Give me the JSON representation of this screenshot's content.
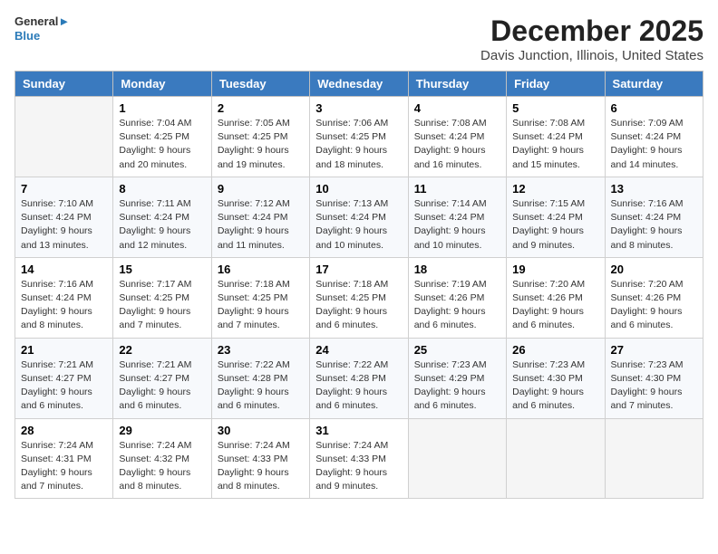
{
  "header": {
    "logo_line1": "General",
    "logo_line2": "Blue",
    "title": "December 2025",
    "subtitle": "Davis Junction, Illinois, United States"
  },
  "weekdays": [
    "Sunday",
    "Monday",
    "Tuesday",
    "Wednesday",
    "Thursday",
    "Friday",
    "Saturday"
  ],
  "weeks": [
    [
      {
        "day": "",
        "info": ""
      },
      {
        "day": "1",
        "info": "Sunrise: 7:04 AM\nSunset: 4:25 PM\nDaylight: 9 hours\nand 20 minutes."
      },
      {
        "day": "2",
        "info": "Sunrise: 7:05 AM\nSunset: 4:25 PM\nDaylight: 9 hours\nand 19 minutes."
      },
      {
        "day": "3",
        "info": "Sunrise: 7:06 AM\nSunset: 4:25 PM\nDaylight: 9 hours\nand 18 minutes."
      },
      {
        "day": "4",
        "info": "Sunrise: 7:08 AM\nSunset: 4:24 PM\nDaylight: 9 hours\nand 16 minutes."
      },
      {
        "day": "5",
        "info": "Sunrise: 7:08 AM\nSunset: 4:24 PM\nDaylight: 9 hours\nand 15 minutes."
      },
      {
        "day": "6",
        "info": "Sunrise: 7:09 AM\nSunset: 4:24 PM\nDaylight: 9 hours\nand 14 minutes."
      }
    ],
    [
      {
        "day": "7",
        "info": "Sunrise: 7:10 AM\nSunset: 4:24 PM\nDaylight: 9 hours\nand 13 minutes."
      },
      {
        "day": "8",
        "info": "Sunrise: 7:11 AM\nSunset: 4:24 PM\nDaylight: 9 hours\nand 12 minutes."
      },
      {
        "day": "9",
        "info": "Sunrise: 7:12 AM\nSunset: 4:24 PM\nDaylight: 9 hours\nand 11 minutes."
      },
      {
        "day": "10",
        "info": "Sunrise: 7:13 AM\nSunset: 4:24 PM\nDaylight: 9 hours\nand 10 minutes."
      },
      {
        "day": "11",
        "info": "Sunrise: 7:14 AM\nSunset: 4:24 PM\nDaylight: 9 hours\nand 10 minutes."
      },
      {
        "day": "12",
        "info": "Sunrise: 7:15 AM\nSunset: 4:24 PM\nDaylight: 9 hours\nand 9 minutes."
      },
      {
        "day": "13",
        "info": "Sunrise: 7:16 AM\nSunset: 4:24 PM\nDaylight: 9 hours\nand 8 minutes."
      }
    ],
    [
      {
        "day": "14",
        "info": "Sunrise: 7:16 AM\nSunset: 4:24 PM\nDaylight: 9 hours\nand 8 minutes."
      },
      {
        "day": "15",
        "info": "Sunrise: 7:17 AM\nSunset: 4:25 PM\nDaylight: 9 hours\nand 7 minutes."
      },
      {
        "day": "16",
        "info": "Sunrise: 7:18 AM\nSunset: 4:25 PM\nDaylight: 9 hours\nand 7 minutes."
      },
      {
        "day": "17",
        "info": "Sunrise: 7:18 AM\nSunset: 4:25 PM\nDaylight: 9 hours\nand 6 minutes."
      },
      {
        "day": "18",
        "info": "Sunrise: 7:19 AM\nSunset: 4:26 PM\nDaylight: 9 hours\nand 6 minutes."
      },
      {
        "day": "19",
        "info": "Sunrise: 7:20 AM\nSunset: 4:26 PM\nDaylight: 9 hours\nand 6 minutes."
      },
      {
        "day": "20",
        "info": "Sunrise: 7:20 AM\nSunset: 4:26 PM\nDaylight: 9 hours\nand 6 minutes."
      }
    ],
    [
      {
        "day": "21",
        "info": "Sunrise: 7:21 AM\nSunset: 4:27 PM\nDaylight: 9 hours\nand 6 minutes."
      },
      {
        "day": "22",
        "info": "Sunrise: 7:21 AM\nSunset: 4:27 PM\nDaylight: 9 hours\nand 6 minutes."
      },
      {
        "day": "23",
        "info": "Sunrise: 7:22 AM\nSunset: 4:28 PM\nDaylight: 9 hours\nand 6 minutes."
      },
      {
        "day": "24",
        "info": "Sunrise: 7:22 AM\nSunset: 4:28 PM\nDaylight: 9 hours\nand 6 minutes."
      },
      {
        "day": "25",
        "info": "Sunrise: 7:23 AM\nSunset: 4:29 PM\nDaylight: 9 hours\nand 6 minutes."
      },
      {
        "day": "26",
        "info": "Sunrise: 7:23 AM\nSunset: 4:30 PM\nDaylight: 9 hours\nand 6 minutes."
      },
      {
        "day": "27",
        "info": "Sunrise: 7:23 AM\nSunset: 4:30 PM\nDaylight: 9 hours\nand 7 minutes."
      }
    ],
    [
      {
        "day": "28",
        "info": "Sunrise: 7:24 AM\nSunset: 4:31 PM\nDaylight: 9 hours\nand 7 minutes."
      },
      {
        "day": "29",
        "info": "Sunrise: 7:24 AM\nSunset: 4:32 PM\nDaylight: 9 hours\nand 8 minutes."
      },
      {
        "day": "30",
        "info": "Sunrise: 7:24 AM\nSunset: 4:33 PM\nDaylight: 9 hours\nand 8 minutes."
      },
      {
        "day": "31",
        "info": "Sunrise: 7:24 AM\nSunset: 4:33 PM\nDaylight: 9 hours\nand 9 minutes."
      },
      {
        "day": "",
        "info": ""
      },
      {
        "day": "",
        "info": ""
      },
      {
        "day": "",
        "info": ""
      }
    ]
  ]
}
